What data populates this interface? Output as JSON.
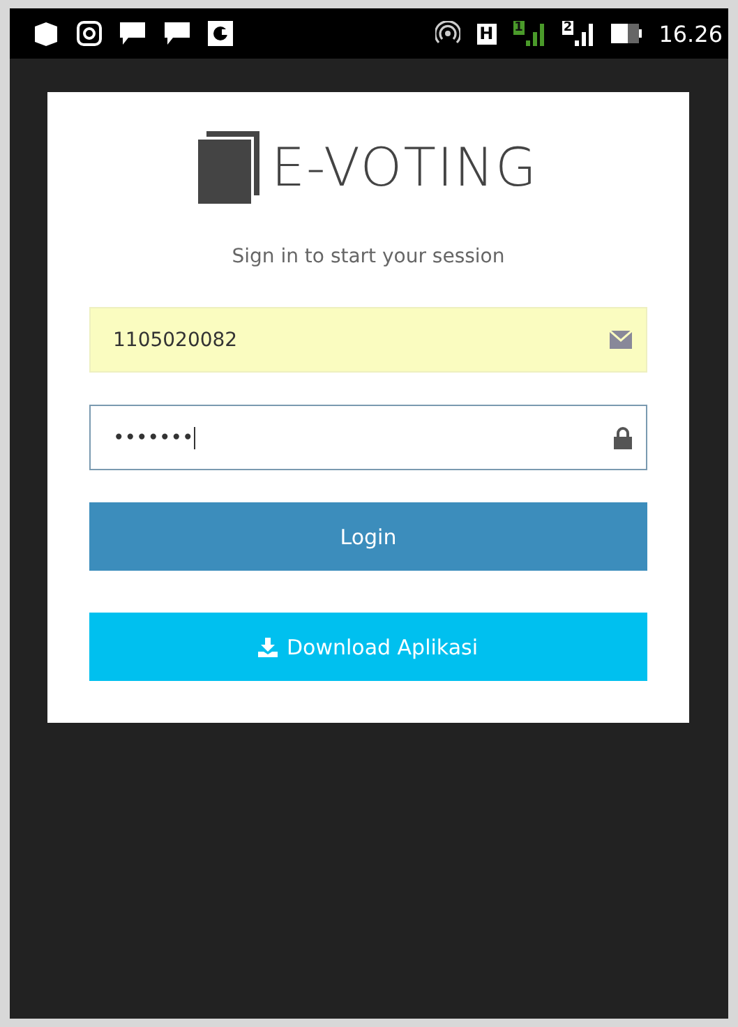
{
  "status_bar": {
    "network_type": "H",
    "sims": [
      {
        "label": "1",
        "active": true
      },
      {
        "label": "2",
        "active": false
      }
    ],
    "time": "16.26"
  },
  "login_box": {
    "title": "E-VOTING",
    "message": "Sign in to start your session",
    "fields": [
      {
        "kind": "username",
        "value": "1105020082",
        "autofilled": true
      },
      {
        "kind": "password",
        "value": "•••••••",
        "autofilled": false
      }
    ],
    "buttons": [
      {
        "kind": "primary",
        "label": "Login"
      },
      {
        "kind": "download",
        "label": "Download Aplikasi"
      }
    ]
  }
}
